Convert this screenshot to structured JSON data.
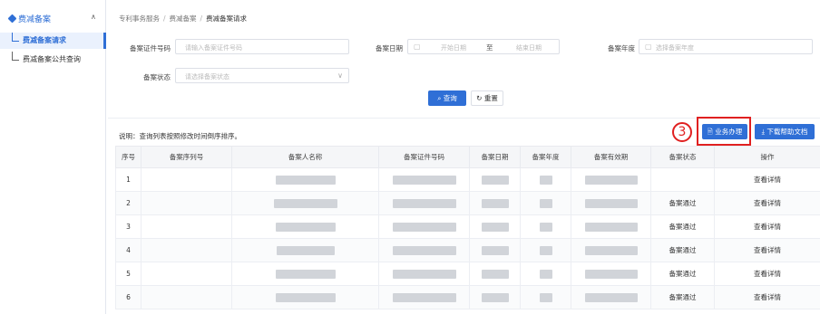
{
  "sidebar": {
    "group_label": "费减备案",
    "items": [
      {
        "label": "费减备案请求",
        "active": true
      },
      {
        "label": "费减备案公共查询",
        "active": false
      }
    ]
  },
  "breadcrumb": [
    "专利事务服务",
    "费减备案",
    "费减备案请求"
  ],
  "form": {
    "cert_no_label": "备案证件号码",
    "cert_no_placeholder": "请输入备案证件号码",
    "date_label": "备案日期",
    "date_start_placeholder": "开始日期",
    "date_to": "至",
    "date_end_placeholder": "结束日期",
    "year_label": "备案年度",
    "year_placeholder": "选择备案年度",
    "status_label": "备案状态",
    "status_placeholder": "请选择备案状态",
    "query_button": "查询",
    "reset_button": "重置"
  },
  "note": "说明：查询列表按照修改时间倒序排序。",
  "toolbar": {
    "business_button": "业务办理",
    "download_button": "下载帮助文档",
    "annotation_number": "3"
  },
  "table": {
    "columns": [
      "序号",
      "备案序列号",
      "备案人名称",
      "备案证件号码",
      "备案日期",
      "备案年度",
      "备案有效期",
      "备案状态",
      "操作"
    ],
    "rows": [
      {
        "index": "1",
        "status": "",
        "action": "查看详情"
      },
      {
        "index": "2",
        "status": "备案通过",
        "action": "查看详情"
      },
      {
        "index": "3",
        "status": "备案通过",
        "action": "查看详情"
      },
      {
        "index": "4",
        "status": "备案通过",
        "action": "查看详情"
      },
      {
        "index": "5",
        "status": "备案通过",
        "action": "查看详情"
      },
      {
        "index": "6",
        "status": "备案通过",
        "action": "查看详情"
      }
    ]
  },
  "colors": {
    "primary": "#2f6fd6",
    "annotation": "#e02020"
  }
}
